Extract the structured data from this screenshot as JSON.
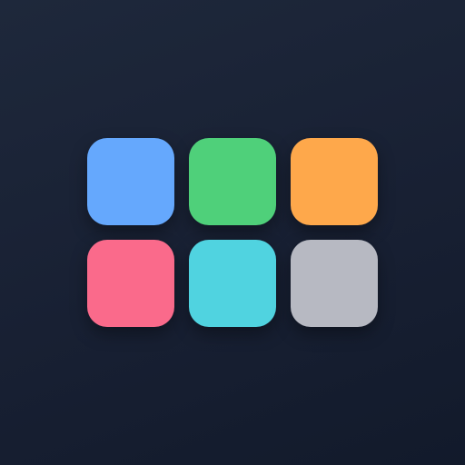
{
  "background": {
    "gradient_colors": [
      "#1e283b",
      "#182033",
      "#121a2b"
    ]
  },
  "tiles": [
    {
      "name": "blue",
      "color": "#65a8fd"
    },
    {
      "name": "green",
      "color": "#4fd07a"
    },
    {
      "name": "orange",
      "color": "#fea84b"
    },
    {
      "name": "pink",
      "color": "#fa6a8b"
    },
    {
      "name": "cyan",
      "color": "#50d3e0"
    },
    {
      "name": "gray",
      "color": "#b7b9c2"
    }
  ]
}
